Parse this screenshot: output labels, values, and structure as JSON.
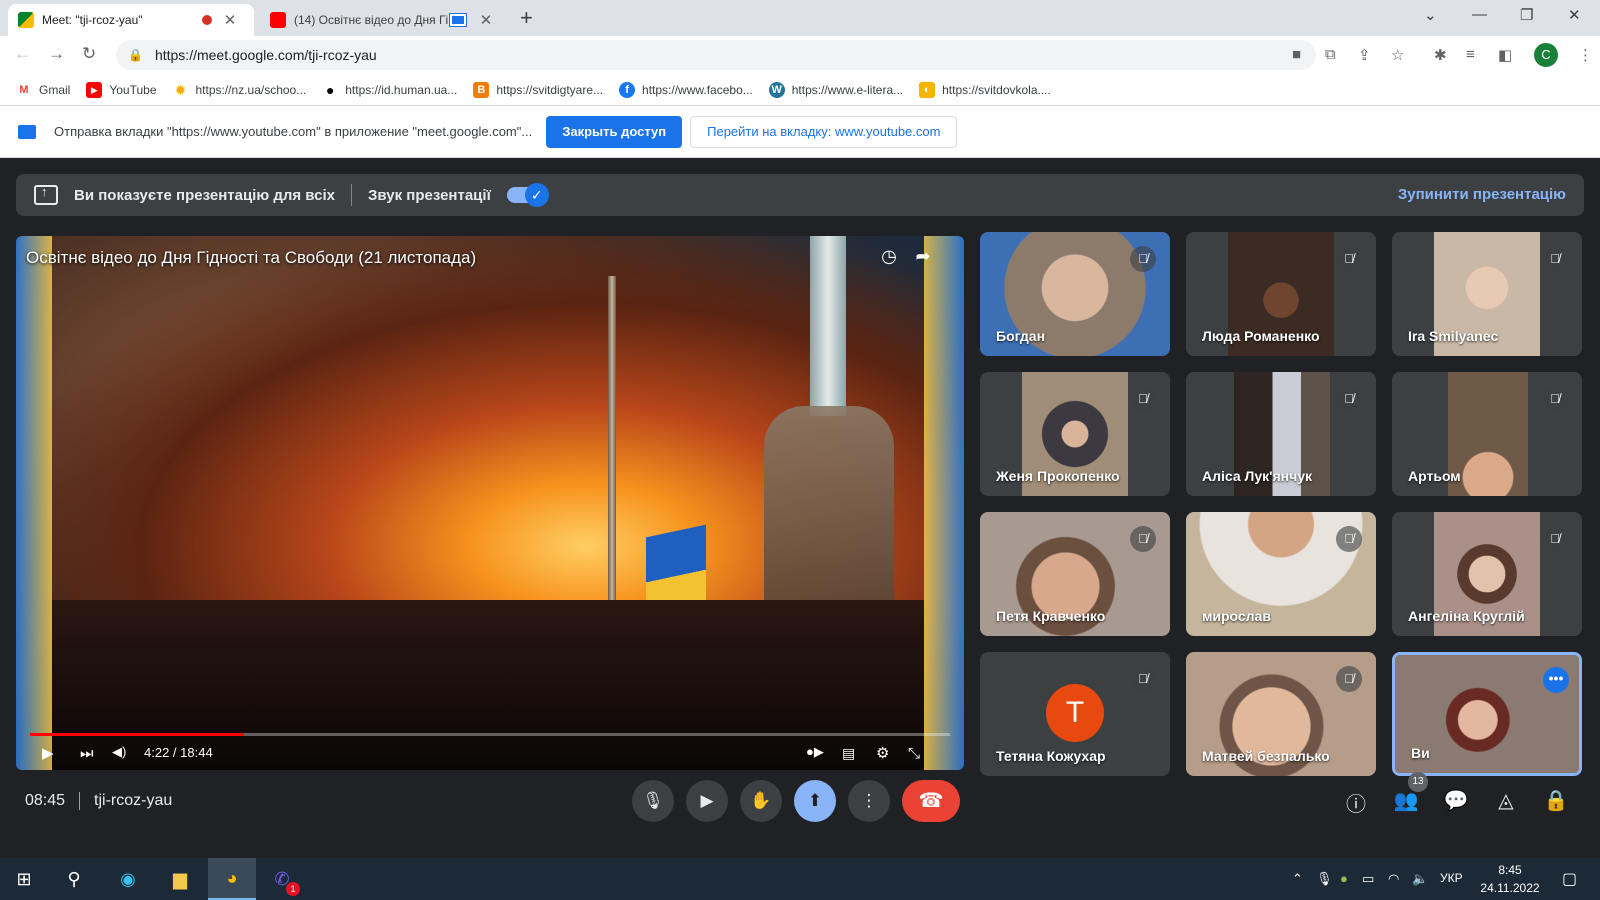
{
  "browser": {
    "tabs": [
      {
        "title": "Meet: \"tji-rcoz-yau\"",
        "active": true,
        "close": "✕"
      },
      {
        "title": "(14) Освітнє відео до Дня Гі",
        "active": false,
        "close": "✕"
      }
    ],
    "new_tab": "+",
    "window_controls": {
      "dropdown": "⌄",
      "minimize": "—",
      "restore": "❐",
      "close": "✕"
    },
    "url": "https://meet.google.com/tji-rcoz-yau",
    "profile_initial": "C",
    "bookmarks": [
      {
        "label": "Gmail",
        "icon": "gmail-icon",
        "color": "#ea4335",
        "glyph": "M"
      },
      {
        "label": "YouTube",
        "icon": "youtube-icon",
        "color": "#ff0000",
        "glyph": "▶"
      },
      {
        "label": "https://nz.ua/schoo...",
        "icon": "sun-icon",
        "color": "#f9ab00",
        "glyph": "✹"
      },
      {
        "label": "https://id.human.ua...",
        "icon": "circle-logo-icon",
        "color": "#000000",
        "glyph": "●"
      },
      {
        "label": "https://svitdigtyare...",
        "icon": "blogger-icon",
        "color": "#f57c00",
        "glyph": "B"
      },
      {
        "label": "https://www.facebo...",
        "icon": "facebook-icon",
        "color": "#1877f2",
        "glyph": "f"
      },
      {
        "label": "https://www.e-litera...",
        "icon": "wordpress-icon",
        "color": "#21759b",
        "glyph": "W"
      },
      {
        "label": "https://svitdovkola....",
        "icon": "site-icon",
        "color": "#f5b400",
        "glyph": "◐"
      }
    ]
  },
  "infobar": {
    "text": "Отправка вкладки \"https://www.youtube.com\" в приложение \"meet.google.com\"...",
    "primary_button": "Закрыть доступ",
    "secondary_button": "Перейти на вкладку: www.youtube.com"
  },
  "presentation": {
    "banner_text": "Ви показуєте презентацію для всіх",
    "audio_label": "Звук презентації",
    "audio_enabled": true,
    "stop_label": "Зупинити презентацію"
  },
  "video": {
    "title": "Освітнє відео до Дня Гідності та Свободи (21 листопада)",
    "time": "4:22 / 18:44",
    "progress_fraction": 0.233
  },
  "participants": [
    {
      "name": "Богдан",
      "muted": true,
      "bg": "#8c7a6b"
    },
    {
      "name": "Люда Романенко",
      "muted": true,
      "bg": "#3b2b22"
    },
    {
      "name": "Ira Smilyanec",
      "muted": true,
      "bg": "#c9b8a6"
    },
    {
      "name": "Женя Прокопенко",
      "muted": true,
      "bg": "#a08d78"
    },
    {
      "name": "Аліса Лук'янчук",
      "muted": true,
      "bg": "#5d5149"
    },
    {
      "name": "Артьом",
      "muted": true,
      "bg": "#6f5a48"
    },
    {
      "name": "Петя Кравченко",
      "muted": true,
      "bg": "#a89a90"
    },
    {
      "name": "мирослав",
      "muted": true,
      "bg": "#c4b59c"
    },
    {
      "name": "Ангеліна Круглій",
      "muted": true,
      "bg": "#a99088"
    },
    {
      "name": "Тетяна Кожухар",
      "muted": true,
      "avatar_letter": "T"
    },
    {
      "name": "Матвей безпалько",
      "muted": true,
      "bg": "#b59d8a"
    },
    {
      "name": "Ви",
      "muted": false,
      "bg": "#8a7a72"
    }
  ],
  "meeting": {
    "time": "08:45",
    "code": "tji-rcoz-yau",
    "participant_count": "13"
  },
  "taskbar": {
    "language": "УКР",
    "time": "8:45",
    "date": "24.11.2022",
    "viber_badge": "1"
  }
}
